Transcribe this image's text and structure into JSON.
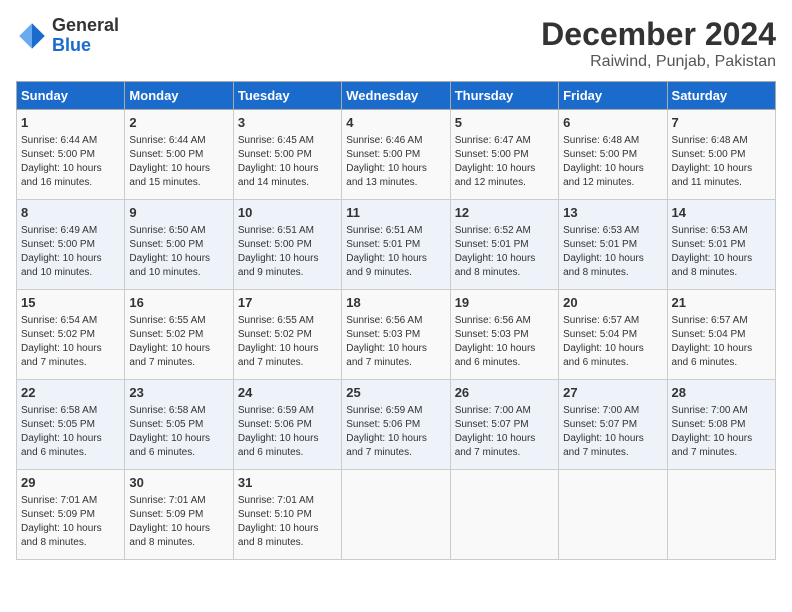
{
  "logo": {
    "general": "General",
    "blue": "Blue"
  },
  "title": "December 2024",
  "location": "Raiwind, Punjab, Pakistan",
  "days_of_week": [
    "Sunday",
    "Monday",
    "Tuesday",
    "Wednesday",
    "Thursday",
    "Friday",
    "Saturday"
  ],
  "weeks": [
    [
      {
        "day": "1",
        "info": "Sunrise: 6:44 AM\nSunset: 5:00 PM\nDaylight: 10 hours\nand 16 minutes."
      },
      {
        "day": "2",
        "info": "Sunrise: 6:44 AM\nSunset: 5:00 PM\nDaylight: 10 hours\nand 15 minutes."
      },
      {
        "day": "3",
        "info": "Sunrise: 6:45 AM\nSunset: 5:00 PM\nDaylight: 10 hours\nand 14 minutes."
      },
      {
        "day": "4",
        "info": "Sunrise: 6:46 AM\nSunset: 5:00 PM\nDaylight: 10 hours\nand 13 minutes."
      },
      {
        "day": "5",
        "info": "Sunrise: 6:47 AM\nSunset: 5:00 PM\nDaylight: 10 hours\nand 12 minutes."
      },
      {
        "day": "6",
        "info": "Sunrise: 6:48 AM\nSunset: 5:00 PM\nDaylight: 10 hours\nand 12 minutes."
      },
      {
        "day": "7",
        "info": "Sunrise: 6:48 AM\nSunset: 5:00 PM\nDaylight: 10 hours\nand 11 minutes."
      }
    ],
    [
      {
        "day": "8",
        "info": "Sunrise: 6:49 AM\nSunset: 5:00 PM\nDaylight: 10 hours\nand 10 minutes."
      },
      {
        "day": "9",
        "info": "Sunrise: 6:50 AM\nSunset: 5:00 PM\nDaylight: 10 hours\nand 10 minutes."
      },
      {
        "day": "10",
        "info": "Sunrise: 6:51 AM\nSunset: 5:00 PM\nDaylight: 10 hours\nand 9 minutes."
      },
      {
        "day": "11",
        "info": "Sunrise: 6:51 AM\nSunset: 5:01 PM\nDaylight: 10 hours\nand 9 minutes."
      },
      {
        "day": "12",
        "info": "Sunrise: 6:52 AM\nSunset: 5:01 PM\nDaylight: 10 hours\nand 8 minutes."
      },
      {
        "day": "13",
        "info": "Sunrise: 6:53 AM\nSunset: 5:01 PM\nDaylight: 10 hours\nand 8 minutes."
      },
      {
        "day": "14",
        "info": "Sunrise: 6:53 AM\nSunset: 5:01 PM\nDaylight: 10 hours\nand 8 minutes."
      }
    ],
    [
      {
        "day": "15",
        "info": "Sunrise: 6:54 AM\nSunset: 5:02 PM\nDaylight: 10 hours\nand 7 minutes."
      },
      {
        "day": "16",
        "info": "Sunrise: 6:55 AM\nSunset: 5:02 PM\nDaylight: 10 hours\nand 7 minutes."
      },
      {
        "day": "17",
        "info": "Sunrise: 6:55 AM\nSunset: 5:02 PM\nDaylight: 10 hours\nand 7 minutes."
      },
      {
        "day": "18",
        "info": "Sunrise: 6:56 AM\nSunset: 5:03 PM\nDaylight: 10 hours\nand 7 minutes."
      },
      {
        "day": "19",
        "info": "Sunrise: 6:56 AM\nSunset: 5:03 PM\nDaylight: 10 hours\nand 6 minutes."
      },
      {
        "day": "20",
        "info": "Sunrise: 6:57 AM\nSunset: 5:04 PM\nDaylight: 10 hours\nand 6 minutes."
      },
      {
        "day": "21",
        "info": "Sunrise: 6:57 AM\nSunset: 5:04 PM\nDaylight: 10 hours\nand 6 minutes."
      }
    ],
    [
      {
        "day": "22",
        "info": "Sunrise: 6:58 AM\nSunset: 5:05 PM\nDaylight: 10 hours\nand 6 minutes."
      },
      {
        "day": "23",
        "info": "Sunrise: 6:58 AM\nSunset: 5:05 PM\nDaylight: 10 hours\nand 6 minutes."
      },
      {
        "day": "24",
        "info": "Sunrise: 6:59 AM\nSunset: 5:06 PM\nDaylight: 10 hours\nand 6 minutes."
      },
      {
        "day": "25",
        "info": "Sunrise: 6:59 AM\nSunset: 5:06 PM\nDaylight: 10 hours\nand 7 minutes."
      },
      {
        "day": "26",
        "info": "Sunrise: 7:00 AM\nSunset: 5:07 PM\nDaylight: 10 hours\nand 7 minutes."
      },
      {
        "day": "27",
        "info": "Sunrise: 7:00 AM\nSunset: 5:07 PM\nDaylight: 10 hours\nand 7 minutes."
      },
      {
        "day": "28",
        "info": "Sunrise: 7:00 AM\nSunset: 5:08 PM\nDaylight: 10 hours\nand 7 minutes."
      }
    ],
    [
      {
        "day": "29",
        "info": "Sunrise: 7:01 AM\nSunset: 5:09 PM\nDaylight: 10 hours\nand 8 minutes."
      },
      {
        "day": "30",
        "info": "Sunrise: 7:01 AM\nSunset: 5:09 PM\nDaylight: 10 hours\nand 8 minutes."
      },
      {
        "day": "31",
        "info": "Sunrise: 7:01 AM\nSunset: 5:10 PM\nDaylight: 10 hours\nand 8 minutes."
      },
      {
        "day": "",
        "info": ""
      },
      {
        "day": "",
        "info": ""
      },
      {
        "day": "",
        "info": ""
      },
      {
        "day": "",
        "info": ""
      }
    ]
  ]
}
